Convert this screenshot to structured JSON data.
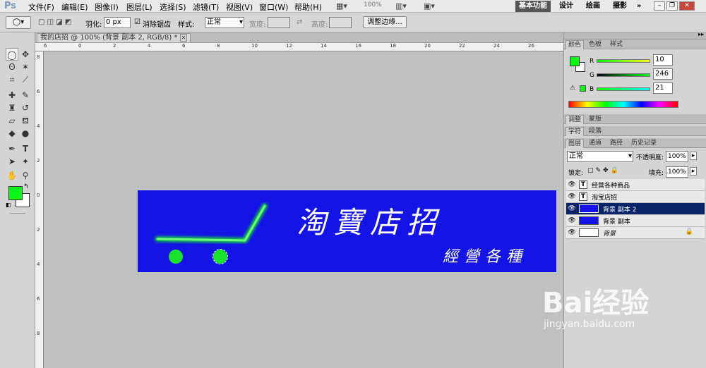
{
  "app": {
    "logo": "Ps"
  },
  "menu": [
    "文件(F)",
    "编辑(E)",
    "图像(I)",
    "图层(L)",
    "选择(S)",
    "滤镜(T)",
    "视图(V)",
    "窗口(W)",
    "帮助(H)"
  ],
  "menubar": {
    "zoom": "100%"
  },
  "workspaces": [
    "基本功能",
    "设计",
    "绘画",
    "摄影",
    "»"
  ],
  "options": {
    "feather_label": "羽化:",
    "feather_value": "0 px",
    "antialias_label": "消除锯齿",
    "style_label": "样式:",
    "style_value": "正常",
    "width_label": "宽度:",
    "height_label": "高度:",
    "refine_button": "调整边缘..."
  },
  "document": {
    "tab_title": "我的店招 @ 100% (背景 副本 2, RGB/8) *"
  },
  "ruler": {
    "h_labels": [
      "6",
      "0",
      "2",
      "4",
      "6",
      "8",
      "10",
      "12",
      "14",
      "16",
      "18",
      "20",
      "22",
      "24",
      "26"
    ],
    "v_labels": [
      "8",
      "6",
      "4",
      "2",
      "0",
      "2",
      "4",
      "6",
      "8"
    ]
  },
  "banner": {
    "title": "淘寶店招",
    "subtitle": "經營各種",
    "bg_color": "#1414e6",
    "cart_color": "#18e22a"
  },
  "color_panel": {
    "tabs": [
      "颜色",
      "色板",
      "样式"
    ],
    "r_label": "R",
    "r_value": "10",
    "g_label": "G",
    "g_value": "246",
    "b_label": "B",
    "b_value": "21",
    "fg_color": "#0af615"
  },
  "adjust_tabs": [
    "调整",
    "蒙版"
  ],
  "char_tabs": [
    "字符",
    "段落"
  ],
  "layers_panel": {
    "tabs": [
      "图层",
      "通道",
      "路径",
      "历史记录"
    ],
    "blend_mode": "正常",
    "opacity_label": "不透明度:",
    "opacity_value": "100%",
    "lock_label": "锁定:",
    "fill_label": "填充:",
    "fill_value": "100%",
    "layers": [
      {
        "name": "经营各种商品",
        "type": "text"
      },
      {
        "name": "淘宝店招",
        "type": "text"
      },
      {
        "name": "背景 副本 2",
        "type": "image",
        "selected": true
      },
      {
        "name": "背景 副本",
        "type": "image"
      },
      {
        "name": "背景",
        "type": "background"
      }
    ]
  },
  "watermark": {
    "brand": "Bai经验",
    "url": "jingyan.baidu.com"
  }
}
